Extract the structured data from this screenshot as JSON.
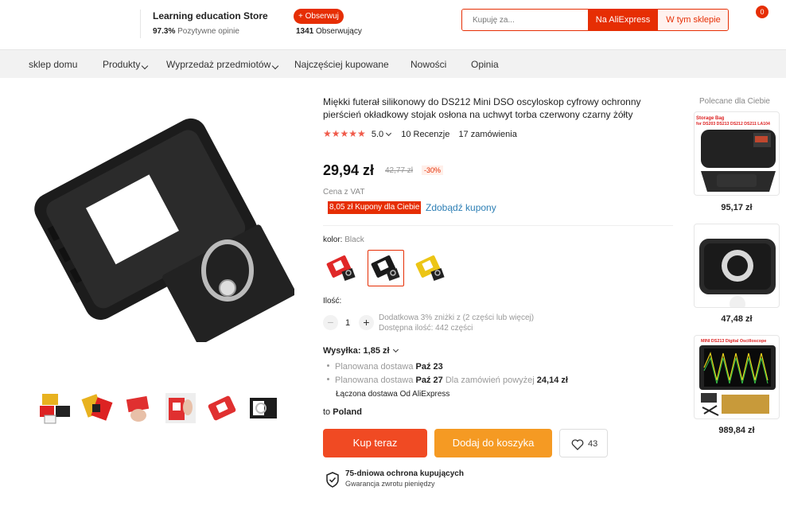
{
  "store": {
    "name": "Learning education Store",
    "rating_pct": "97.3%",
    "rating_label": "Pozytywne opinie",
    "follow_label": "+ Obserwuj",
    "followers_count": "1341",
    "followers_label": "Obserwujący"
  },
  "search": {
    "placeholder": "Kupuję za...",
    "btn_aliexpress": "Na AliExpress",
    "btn_store": "W tym sklepie"
  },
  "cart": {
    "count": "0"
  },
  "nav": {
    "items": [
      {
        "label": "sklep domu"
      },
      {
        "label": "Produkty"
      },
      {
        "label": "Wyprzedaż przedmiotów"
      },
      {
        "label": "Najczęściej kupowane"
      },
      {
        "label": "Nowości"
      },
      {
        "label": "Opinia"
      }
    ]
  },
  "product": {
    "title": "Miękki futerał silikonowy do DS212 Mini DSO oscyloskop cyfrowy ochronny pierścień okładkowy stojak osłona na uchwyt torba czerwony czarny żółty",
    "stars": "★★★★★",
    "rating": "5.0",
    "reviews": "10 Recenzje",
    "orders": "17 zamówienia",
    "price": "29,94 zł",
    "old_price": "42,77 zł",
    "discount": "-30%",
    "vat": "Cena z VAT",
    "coupon": "8,05 zł Kupony dla Ciebie",
    "get_coupons": "Zdobądź kupony",
    "color_label": "kolor:",
    "color_value": "Black",
    "selected_swatch": 1,
    "qty_label": "Ilość:",
    "qty_value": "1",
    "qty_info1": "Dodatkowa 3% zniżki z (2 części lub więcej)",
    "qty_info2": "Dostępna ilość: 442 części"
  },
  "shipping": {
    "label": "Wysyłka: 1,85 zł",
    "line1_text": "Planowana dostawa",
    "line1_date": "Paź 23",
    "line2_text": "Planowana dostawa",
    "line2_date": "Paź 27",
    "line2_cond": "Dla zamówień powyżej",
    "line2_amount": "24,14 zł",
    "combined": "Łączona dostawa  Od AliExpress",
    "to_label": "to",
    "to_country": "Poland"
  },
  "actions": {
    "buy_now": "Kup teraz",
    "add_to_cart": "Dodaj do koszyka",
    "wishlist_count": "43"
  },
  "protection": {
    "title": "75-dniowa ochrona kupujących",
    "subtitle": "Gwarancja zwrotu pieniędzy"
  },
  "recommended": {
    "title": "Polecane dla Ciebie",
    "items": [
      {
        "price": "95,17 zł",
        "label1": "Storage Bag",
        "label2": "for DS203 DS213 DS212 DS211 LA104"
      },
      {
        "price": "47,48 zł"
      },
      {
        "price": "989,84 zł",
        "label1": "MINI DS213 Digital Oscilloscope"
      }
    ]
  },
  "colors": {
    "accent": "#e62e04",
    "buy": "#f04a23",
    "cart": "#f59a23",
    "link": "#2d7fb5",
    "star": "#f05a4a"
  }
}
